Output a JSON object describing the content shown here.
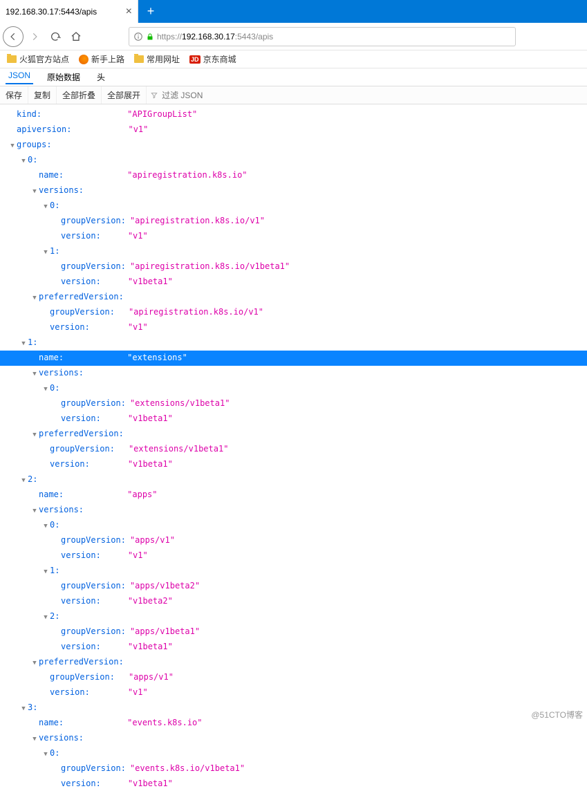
{
  "browser": {
    "tab_title": "192.168.30.17:5443/apis",
    "url_display": {
      "prefix": "https://",
      "host": "192.168.30.17",
      "port": ":5443",
      "path": "/apis"
    }
  },
  "bookmarks": [
    {
      "label": "火狐官方站点",
      "icon": "folder"
    },
    {
      "label": "新手上路",
      "icon": "firefox"
    },
    {
      "label": "常用网址",
      "icon": "folder"
    },
    {
      "label": "京东商城",
      "icon": "jd"
    }
  ],
  "viewer_tabs": {
    "json": "JSON",
    "raw": "原始数据",
    "headers": "头"
  },
  "toolbar": {
    "save": "保存",
    "copy": "复制",
    "collapse_all": "全部折叠",
    "expand_all": "全部展开",
    "filter_placeholder": "过滤 JSON"
  },
  "json_rows": [
    {
      "d": 0,
      "tri": "none",
      "key": "kind",
      "val": "\"APIGroupList\""
    },
    {
      "d": 0,
      "tri": "none",
      "key": "apiversion",
      "val": "\"v1\""
    },
    {
      "d": 0,
      "tri": "open",
      "key": "groups",
      "val": null
    },
    {
      "d": 1,
      "tri": "open",
      "key": "0",
      "val": null
    },
    {
      "d": 2,
      "tri": "none",
      "key": "name",
      "val": "\"apiregistration.k8s.io\""
    },
    {
      "d": 2,
      "tri": "open",
      "key": "versions",
      "val": null
    },
    {
      "d": 3,
      "tri": "open",
      "key": "0",
      "val": null
    },
    {
      "d": 4,
      "tri": "none",
      "key": "groupVersion",
      "val": "\"apiregistration.k8s.io/v1\""
    },
    {
      "d": 4,
      "tri": "none",
      "key": "version",
      "val": "\"v1\""
    },
    {
      "d": 3,
      "tri": "open",
      "key": "1",
      "val": null
    },
    {
      "d": 4,
      "tri": "none",
      "key": "groupVersion",
      "val": "\"apiregistration.k8s.io/v1beta1\""
    },
    {
      "d": 4,
      "tri": "none",
      "key": "version",
      "val": "\"v1beta1\""
    },
    {
      "d": 2,
      "tri": "open",
      "key": "preferredVersion",
      "val": null
    },
    {
      "d": 3,
      "tri": "none",
      "key": "groupVersion",
      "val": "\"apiregistration.k8s.io/v1\""
    },
    {
      "d": 3,
      "tri": "none",
      "key": "version",
      "val": "\"v1\""
    },
    {
      "d": 1,
      "tri": "open",
      "key": "1",
      "val": null
    },
    {
      "d": 2,
      "tri": "none",
      "key": "name",
      "val": "\"extensions\"",
      "sel": true
    },
    {
      "d": 2,
      "tri": "open",
      "key": "versions",
      "val": null
    },
    {
      "d": 3,
      "tri": "open",
      "key": "0",
      "val": null
    },
    {
      "d": 4,
      "tri": "none",
      "key": "groupVersion",
      "val": "\"extensions/v1beta1\""
    },
    {
      "d": 4,
      "tri": "none",
      "key": "version",
      "val": "\"v1beta1\""
    },
    {
      "d": 2,
      "tri": "open",
      "key": "preferredVersion",
      "val": null
    },
    {
      "d": 3,
      "tri": "none",
      "key": "groupVersion",
      "val": "\"extensions/v1beta1\""
    },
    {
      "d": 3,
      "tri": "none",
      "key": "version",
      "val": "\"v1beta1\""
    },
    {
      "d": 1,
      "tri": "open",
      "key": "2",
      "val": null
    },
    {
      "d": 2,
      "tri": "none",
      "key": "name",
      "val": "\"apps\""
    },
    {
      "d": 2,
      "tri": "open",
      "key": "versions",
      "val": null
    },
    {
      "d": 3,
      "tri": "open",
      "key": "0",
      "val": null
    },
    {
      "d": 4,
      "tri": "none",
      "key": "groupVersion",
      "val": "\"apps/v1\""
    },
    {
      "d": 4,
      "tri": "none",
      "key": "version",
      "val": "\"v1\""
    },
    {
      "d": 3,
      "tri": "open",
      "key": "1",
      "val": null
    },
    {
      "d": 4,
      "tri": "none",
      "key": "groupVersion",
      "val": "\"apps/v1beta2\""
    },
    {
      "d": 4,
      "tri": "none",
      "key": "version",
      "val": "\"v1beta2\""
    },
    {
      "d": 3,
      "tri": "open",
      "key": "2",
      "val": null
    },
    {
      "d": 4,
      "tri": "none",
      "key": "groupVersion",
      "val": "\"apps/v1beta1\""
    },
    {
      "d": 4,
      "tri": "none",
      "key": "version",
      "val": "\"v1beta1\""
    },
    {
      "d": 2,
      "tri": "open",
      "key": "preferredVersion",
      "val": null
    },
    {
      "d": 3,
      "tri": "none",
      "key": "groupVersion",
      "val": "\"apps/v1\""
    },
    {
      "d": 3,
      "tri": "none",
      "key": "version",
      "val": "\"v1\""
    },
    {
      "d": 1,
      "tri": "open",
      "key": "3",
      "val": null
    },
    {
      "d": 2,
      "tri": "none",
      "key": "name",
      "val": "\"events.k8s.io\""
    },
    {
      "d": 2,
      "tri": "open",
      "key": "versions",
      "val": null
    },
    {
      "d": 3,
      "tri": "open",
      "key": "0",
      "val": null
    },
    {
      "d": 4,
      "tri": "none",
      "key": "groupVersion",
      "val": "\"events.k8s.io/v1beta1\""
    },
    {
      "d": 4,
      "tri": "none",
      "key": "version",
      "val": "\"v1beta1\""
    }
  ],
  "watermark": "@51CTO博客"
}
